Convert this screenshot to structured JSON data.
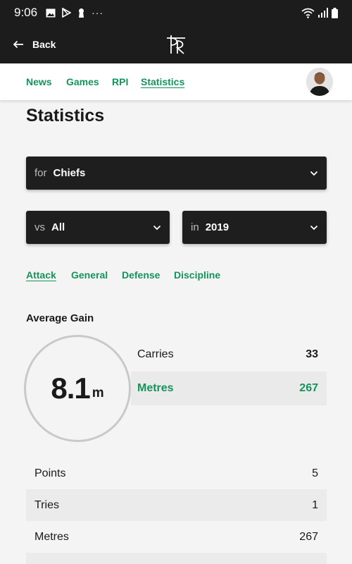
{
  "status_bar": {
    "time": "9:06",
    "left_icons": [
      "image-icon",
      "play-store-icon",
      "keyhole-icon",
      "more-dots-icon"
    ],
    "right_icons": [
      "wifi-icon",
      "signal-icon",
      "battery-icon"
    ],
    "more_glyph": "···"
  },
  "header": {
    "back_label": "Back",
    "logo_icon": "pr-monogram-logo"
  },
  "nav": {
    "tabs": [
      {
        "label": "News"
      },
      {
        "label": "Games"
      },
      {
        "label": "RPI"
      },
      {
        "label": "Statistics",
        "active": true
      }
    ]
  },
  "page_title": "Statistics",
  "filters": {
    "team": {
      "prefix": "for",
      "value": "Chiefs"
    },
    "opponent": {
      "prefix": "vs",
      "value": "All"
    },
    "season": {
      "prefix": "in",
      "value": "2019"
    }
  },
  "sub_tabs": [
    {
      "label": "Attack",
      "active": true
    },
    {
      "label": "General"
    },
    {
      "label": "Defense"
    },
    {
      "label": "Discipline"
    }
  ],
  "average_gain": {
    "title": "Average Gain",
    "value": "8.1",
    "unit": "m",
    "rows": [
      {
        "label": "Carries",
        "value": "33"
      },
      {
        "label": "Metres",
        "value": "267",
        "highlight": true
      }
    ]
  },
  "stats": [
    {
      "label": "Points",
      "value": "5"
    },
    {
      "label": "Tries",
      "value": "1"
    },
    {
      "label": "Metres",
      "value": "267"
    }
  ],
  "colors": {
    "accent": "#14945c",
    "dark": "#1c1c1c",
    "background": "#f4f4f4"
  }
}
